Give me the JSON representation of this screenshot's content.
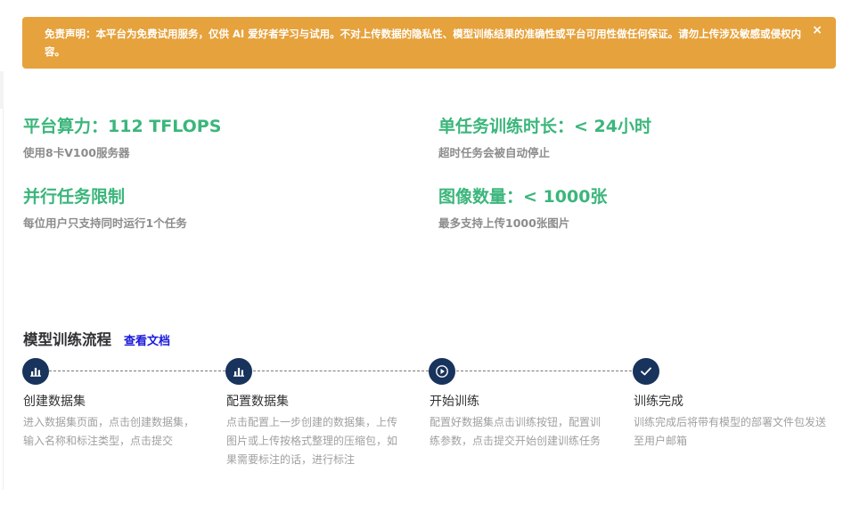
{
  "banner": {
    "text": "免责声明：本平台为免费试用服务，仅供 AI 爱好者学习与试用。不对上传数据的隐私性、模型训练结果的准确性或平台可用性做任何保证。请勿上传涉及敏感或侵权内容。",
    "close_symbol": "×",
    "color": "#e6a23c"
  },
  "stats": [
    {
      "title": "平台算力：112 TFLOPS",
      "desc": "使用8卡V100服务器"
    },
    {
      "title": "单任务训练时长：< 24小时",
      "desc": "超时任务会被自动停止"
    },
    {
      "title": "并行任务限制",
      "desc": "每位用户只支持同时运行1个任务"
    },
    {
      "title": "图像数量：< 1000张",
      "desc": "最多支持上传1000张图片"
    }
  ],
  "workflow": {
    "title": "模型训练流程",
    "doc_link": "查看文档",
    "steps": [
      {
        "icon": "bar-chart-icon",
        "title": "创建数据集",
        "desc": "进入数据集页面，点击创建数据集，输入名称和标注类型，点击提交"
      },
      {
        "icon": "bar-chart-icon",
        "title": "配置数据集",
        "desc": "点击配置上一步创建的数据集，上传图片或上传按格式整理的压缩包，如果需要标注的话，进行标注"
      },
      {
        "icon": "play-icon",
        "title": "开始训练",
        "desc": "配置好数据集点击训练按钮，配置训练参数，点击提交开始创建训练任务"
      },
      {
        "icon": "check-icon",
        "title": "训练完成",
        "desc": "训练完成后将带有模型的部署文件包发送至用户邮箱"
      }
    ]
  },
  "colors": {
    "accent_green": "#3bb67b",
    "step_icon_bg": "#18335c",
    "link": "#1a1adb"
  }
}
